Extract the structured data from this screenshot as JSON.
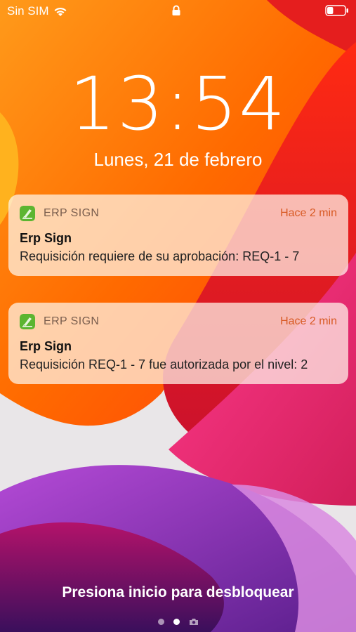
{
  "status_bar": {
    "carrier": "Sin SIM",
    "wifi_icon": "wifi-icon",
    "lock_icon": "lock-icon",
    "battery_icon": "battery-icon",
    "battery_level": 0.35
  },
  "lock_screen": {
    "time": "13:54",
    "date": "Lunes, 21 de febrero",
    "unlock_hint": "Presiona inicio para desbloquear",
    "page_indicator": {
      "pages": 3,
      "active_index": 1,
      "camera_icon": "camera-icon"
    }
  },
  "notifications": [
    {
      "app_name": "ERP SIGN",
      "app_icon": "erp-sign-app-icon",
      "time_ago": "Hace 2 min",
      "title": "Erp Sign",
      "body": "Requisición requiere de su aprobación: REQ-1 - 7"
    },
    {
      "app_name": "ERP SIGN",
      "app_icon": "erp-sign-app-icon",
      "time_ago": "Hace 2 min",
      "title": "Erp Sign",
      "body": "Requisición REQ-1 - 7 fue autorizada por el nivel: 2"
    }
  ],
  "colors": {
    "accent_time": "#d85a24",
    "wallpaper_orange": "#ff6a00",
    "wallpaper_red": "#e4162a",
    "wallpaper_purple": "#8a2cb0"
  }
}
